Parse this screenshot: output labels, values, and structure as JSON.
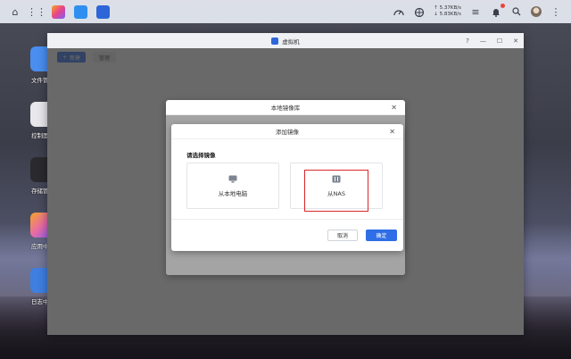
{
  "taskbar": {
    "net_up": "↑ 5.37KB/s",
    "net_down": "↓ 5.83KB/s"
  },
  "desktop": {
    "icons": [
      {
        "label": "文件管理",
        "color": "#4a8ef0"
      },
      {
        "label": "控制面板",
        "color": "#e8e8ec"
      },
      {
        "label": "存储管理",
        "color": "#2a2a2e"
      },
      {
        "label": "应用中心",
        "color": "#e86aa8"
      },
      {
        "label": "日志中心",
        "color": "#3e7fe0"
      }
    ]
  },
  "window": {
    "title": "虚拟机",
    "help": "?",
    "new_button": "新建",
    "manage_button": "管理"
  },
  "outer_dialog": {
    "title": "本地镜像库"
  },
  "inner_dialog": {
    "title": "添加镜像",
    "section_label": "请选择镜像",
    "option_local": "从本地电脑",
    "option_nas": "从NAS",
    "cancel": "取消",
    "confirm": "确定"
  },
  "colors": {
    "accent": "#2f6ee6",
    "highlight": "#d8262a"
  }
}
